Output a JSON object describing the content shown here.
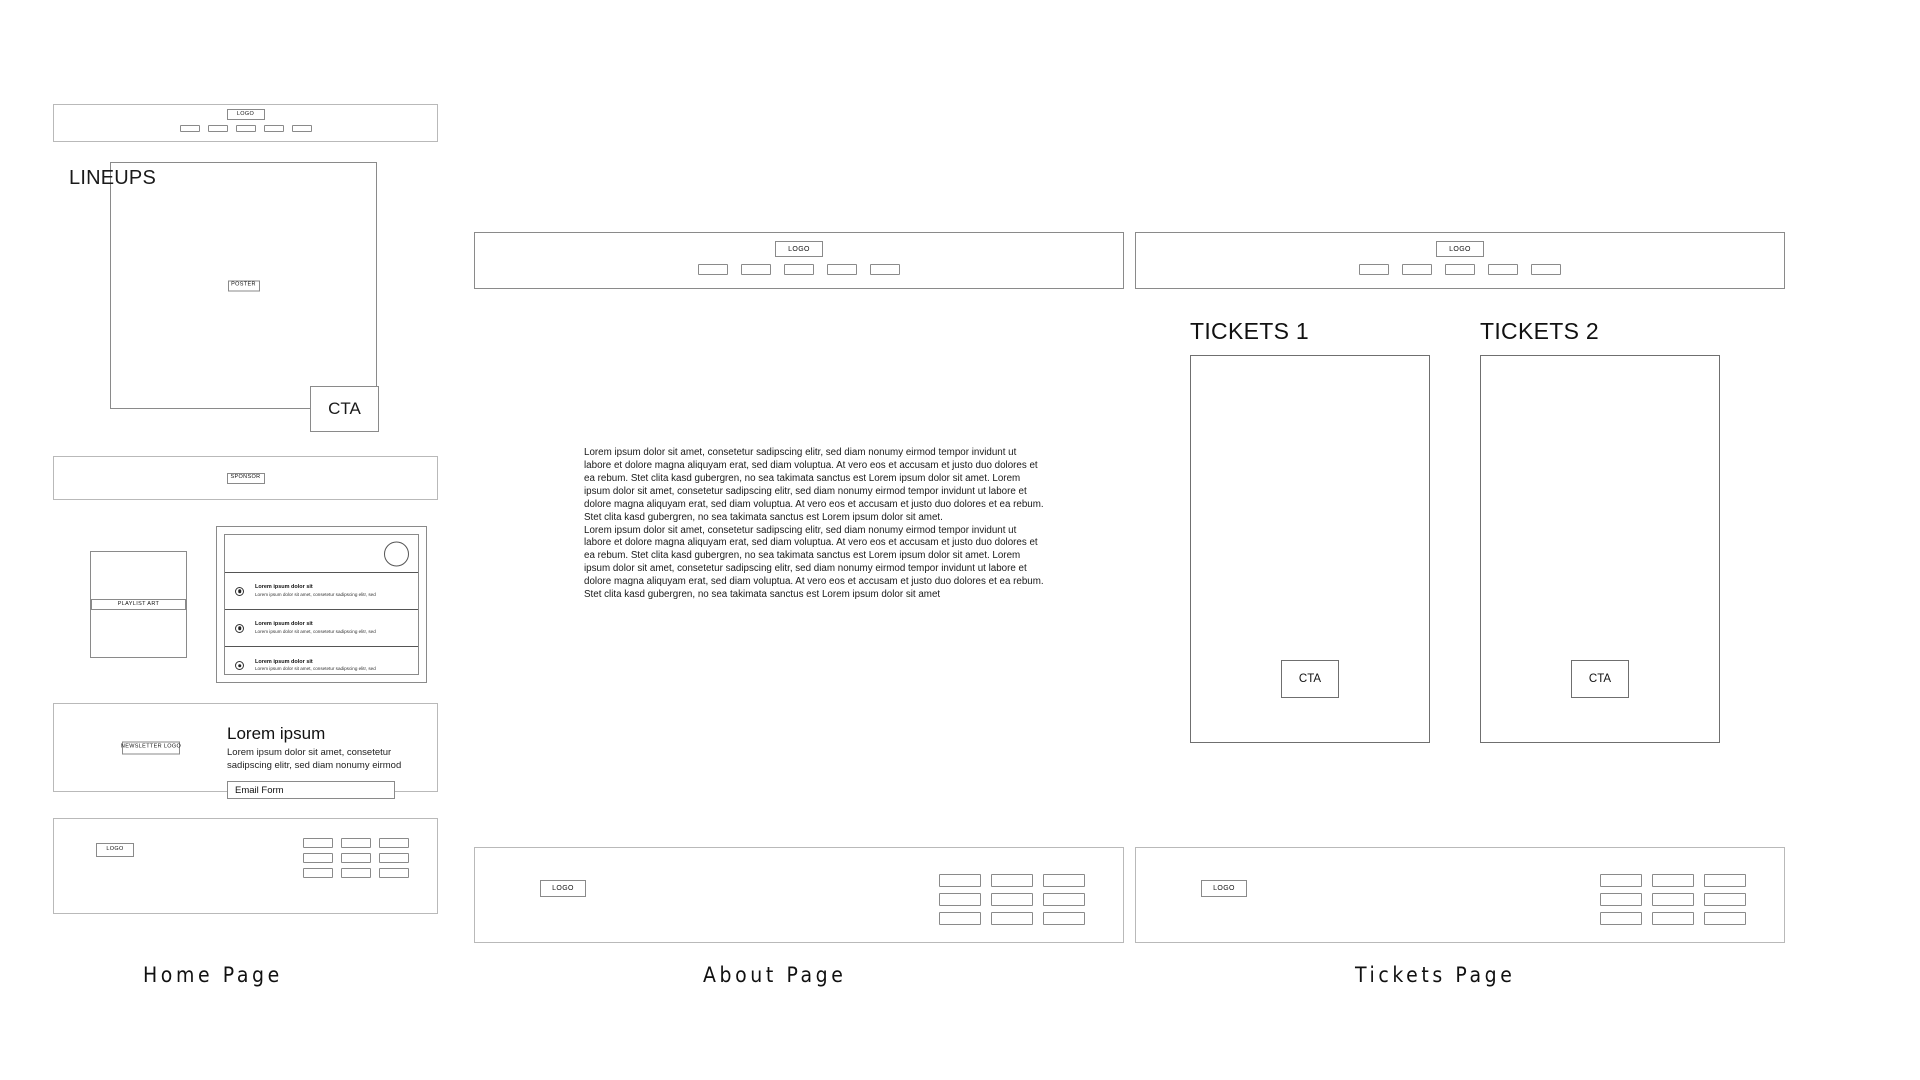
{
  "meta": {
    "background": "#ffffff",
    "stroke_dark": "#7d7d7d",
    "stroke_light": "#b9b9b9"
  },
  "captions": {
    "home": "Home Page",
    "about": "About Page",
    "tickets": "Tickets Page"
  },
  "home": {
    "header": {
      "logo_label": "LOGO",
      "nav_items": [
        "",
        "",
        "",
        "",
        ""
      ]
    },
    "hero": {
      "title": "LINEUPS",
      "poster_label": "POSTER",
      "cta_label": "CTA"
    },
    "sponsor": {
      "label": "SPONSOR"
    },
    "playlist": {
      "art_label": "PLAYLIST ART",
      "rows": [
        {
          "title": "Lorem ipsum dolor sit",
          "subtitle": "Lorem ipsum dolor sit amet, consetetur sadipscing elitr, sed"
        },
        {
          "title": "Lorem ipsum dolor sit",
          "subtitle": "Lorem ipsum dolor sit amet, consetetur sadipscing elitr, sed"
        },
        {
          "title": "Lorem ipsum dolor sit",
          "subtitle": "Lorem ipsum dolor sit amet, consetetur sadipscing elitr, sed"
        }
      ]
    },
    "newsletter": {
      "logo_label": "NEWSLETTER LOGO",
      "heading": "Lorem ipsum",
      "description": "Lorem ipsum dolor sit amet, consetetur sadipscing elitr, sed diam nonumy eirmod",
      "form_label": "Email Form"
    },
    "footer": {
      "logo_label": "LOGO",
      "links": [
        "",
        "",
        "",
        "",
        "",
        "",
        "",
        "",
        ""
      ]
    }
  },
  "about": {
    "header": {
      "logo_label": "LOGO",
      "nav_items": [
        "",
        "",
        "",
        "",
        ""
      ]
    },
    "body": {
      "paragraph_1": "Lorem ipsum dolor sit amet, consetetur sadipscing elitr, sed diam nonumy eirmod tempor invidunt ut labore et dolore magna aliquyam erat, sed diam voluptua. At vero eos et accusam et justo duo dolores et ea rebum. Stet clita kasd gubergren, no sea takimata sanctus est Lorem ipsum dolor sit amet. Lorem ipsum dolor sit amet, consetetur sadipscing elitr, sed diam nonumy eirmod tempor invidunt ut labore et dolore magna aliquyam erat, sed diam voluptua. At vero eos et accusam et justo duo dolores et ea rebum. Stet clita kasd gubergren, no sea takimata sanctus est Lorem ipsum dolor sit amet.",
      "paragraph_2": "Lorem ipsum dolor sit amet, consetetur sadipscing elitr, sed diam nonumy eirmod tempor invidunt ut labore et dolore magna aliquyam erat, sed diam voluptua. At vero eos et accusam et justo duo dolores et ea rebum. Stet clita kasd gubergren, no sea takimata sanctus est Lorem ipsum dolor sit amet. Lorem ipsum dolor sit amet, consetetur sadipscing elitr, sed diam nonumy eirmod tempor invidunt ut labore et dolore magna aliquyam erat, sed diam voluptua. At vero eos et accusam et justo duo dolores et ea rebum. Stet clita kasd gubergren, no sea takimata sanctus est Lorem ipsum dolor sit amet"
    },
    "footer": {
      "logo_label": "LOGO",
      "links": [
        "",
        "",
        "",
        "",
        "",
        "",
        "",
        "",
        ""
      ]
    }
  },
  "tickets": {
    "header": {
      "logo_label": "LOGO",
      "nav_items": [
        "",
        "",
        "",
        "",
        ""
      ]
    },
    "cards": [
      {
        "title": "TICKETS 1",
        "cta_label": "CTA"
      },
      {
        "title": "TICKETS 2",
        "cta_label": "CTA"
      }
    ],
    "footer": {
      "logo_label": "LOGO",
      "links": [
        "",
        "",
        "",
        "",
        "",
        "",
        "",
        "",
        ""
      ]
    }
  }
}
